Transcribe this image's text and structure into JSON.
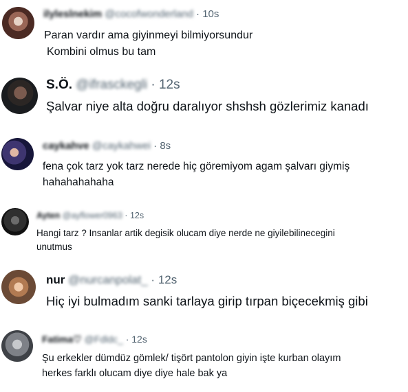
{
  "replies": [
    {
      "name": "ilyleslnekim",
      "handle": "@cocofwonderland",
      "time": "10s",
      "lines": [
        "Paran vardır ama giyinmeyi bilmiyorsundur",
        "Kombini olmus bu tam"
      ]
    },
    {
      "name": "S.Ö.",
      "handle": "@ifrasckegli",
      "time": "12s",
      "lines": [
        "Şalvar niye alta doğru daralıyor shshsh gözlerimiz kanadı"
      ]
    },
    {
      "name": "caykahve",
      "handle": "@caykahwei",
      "time": "8s",
      "lines": [
        "fena çok tarz yok tarz nerede hiç göremiyom agam şalvarı giymiş",
        "hahahahahaha"
      ]
    },
    {
      "name": "Ayten",
      "handle": "@ayflower0963",
      "time": "12s",
      "lines": [
        "Hangi tarz ? Insanlar artik degisik olucam diye nerde ne giyilebilinecegini",
        "unutmus"
      ]
    },
    {
      "name": "nur",
      "handle": "@nurcanpolat_",
      "time": "12s",
      "lines": [
        "Hiç iyi bulmadım sanki tarlaya girip tırpan biçecekmiş gibi"
      ]
    },
    {
      "name": "Fatima♡",
      "handle": "@Fdldc_",
      "time": "12s",
      "lines": [
        "Şu erkekler dümdüz gömlek/ tişört pantolon giyin işte kurban olayım",
        "herkes farklı olucam diye diye hale bak ya"
      ]
    }
  ],
  "separator": "·"
}
